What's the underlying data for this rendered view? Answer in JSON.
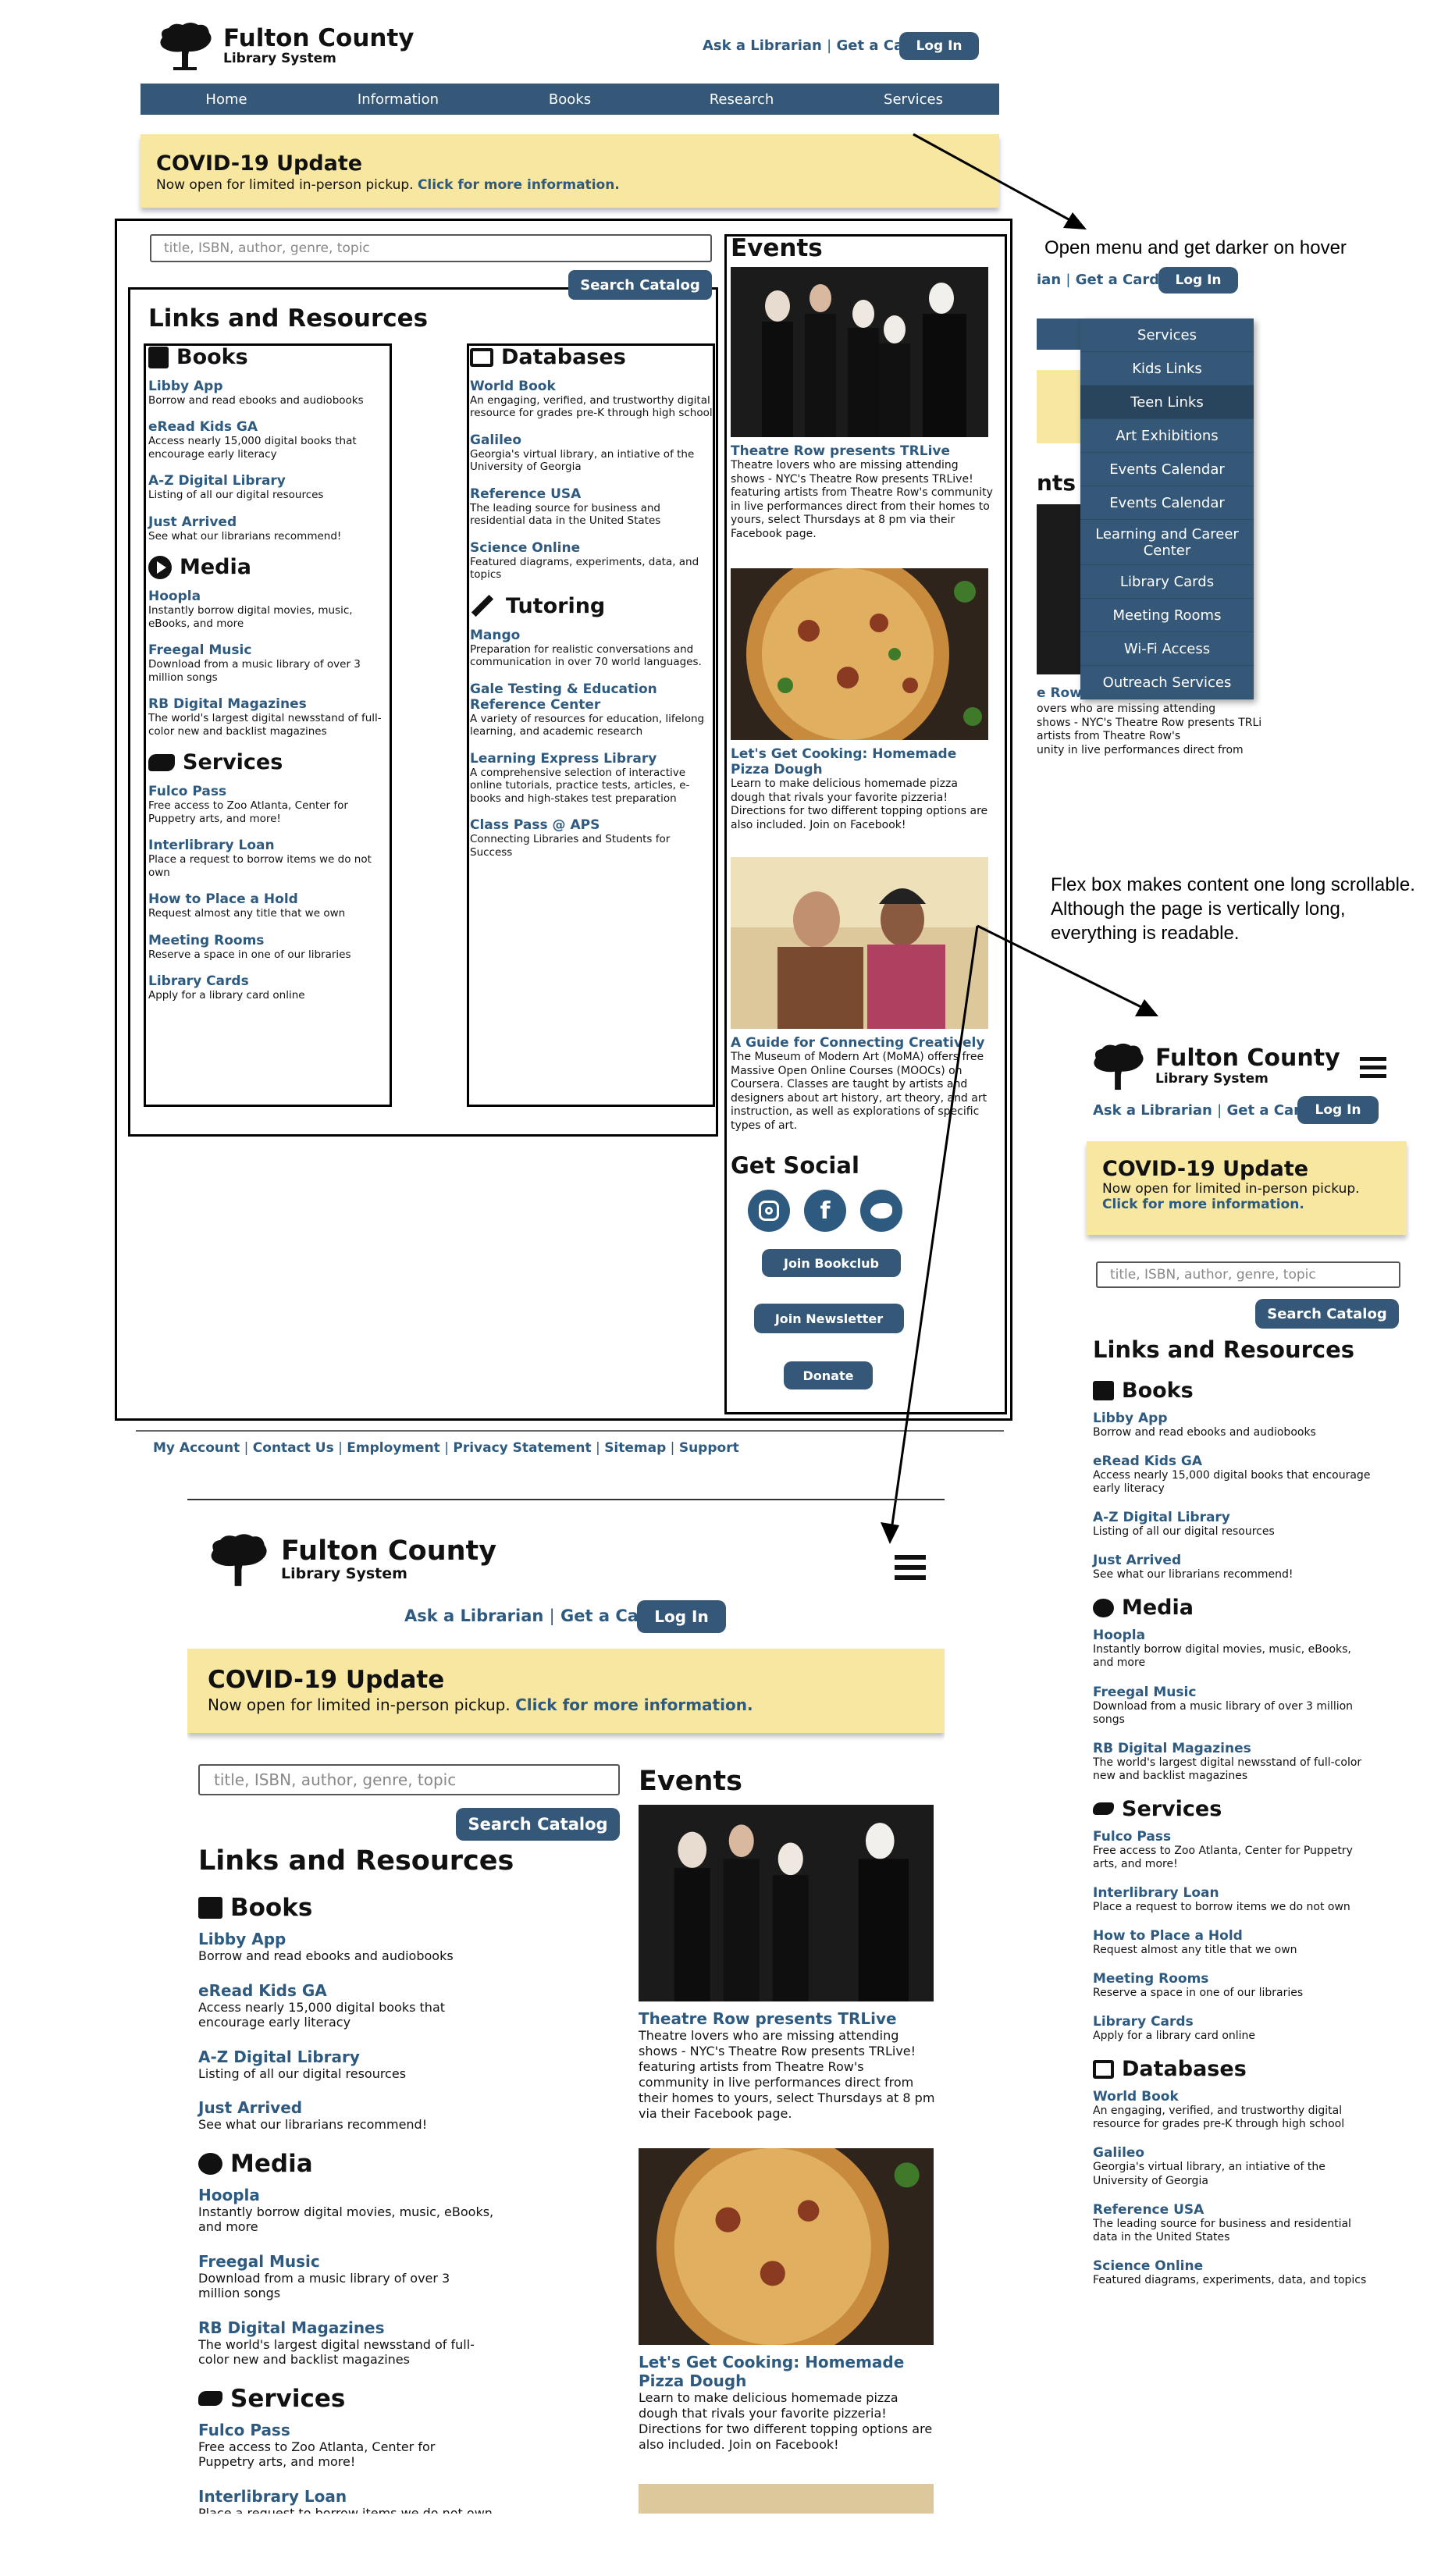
{
  "brand": {
    "title": "Fulton County",
    "subtitle": "Library System"
  },
  "header": {
    "ask": "Ask a Librarian",
    "sep": "|",
    "card": "Get a Card",
    "login": "Log In"
  },
  "nav": [
    "Home",
    "Information",
    "Books",
    "Research",
    "Services"
  ],
  "covid": {
    "title": "COVID-19 Update",
    "text": "Now open for limited in-person pickup.",
    "link": "Click for more information."
  },
  "search": {
    "placeholder": "title, ISBN, author, genre, topic",
    "button": "Search Catalog"
  },
  "links_title": "Links and Resources",
  "categories": {
    "books": {
      "title": "Books",
      "items": [
        {
          "t": "Libby App",
          "d": "Borrow and read ebooks and audiobooks"
        },
        {
          "t": "eRead Kids GA",
          "d": "Access nearly 15,000 digital books that encourage early literacy"
        },
        {
          "t": "A-Z Digital Library",
          "d": "Listing of all our digital resources"
        },
        {
          "t": "Just Arrived",
          "d": "See what our librarians recommend!"
        }
      ]
    },
    "media": {
      "title": "Media",
      "items": [
        {
          "t": "Hoopla",
          "d": "Instantly borrow digital movies, music, eBooks, and more"
        },
        {
          "t": "Freegal Music",
          "d": "Download from a music library of over 3 million songs"
        },
        {
          "t": "RB Digital Magazines",
          "d": "The world's largest digital newsstand of full-color new and backlist magazines"
        }
      ]
    },
    "services": {
      "title": "Services",
      "items": [
        {
          "t": "Fulco Pass",
          "d": "Free access to Zoo Atlanta, Center for Puppetry arts, and more!"
        },
        {
          "t": "Interlibrary Loan",
          "d": "Place a request to borrow items we do not own"
        },
        {
          "t": "How to Place a Hold",
          "d": "Request almost any title that we own"
        },
        {
          "t": "Meeting Rooms",
          "d": "Reserve a space in one of our libraries"
        },
        {
          "t": "Library Cards",
          "d": "Apply for a library card online"
        }
      ]
    },
    "databases": {
      "title": "Databases",
      "items": [
        {
          "t": "World Book",
          "d": "An engaging, verified, and trustworthy digital resource for grades pre-K through high school"
        },
        {
          "t": "Galileo",
          "d": "Georgia's virtual library, an intiative of the University of Georgia"
        },
        {
          "t": "Reference USA",
          "d": "The leading source for business and residential data in the United States"
        },
        {
          "t": "Science Online",
          "d": "Featured diagrams, experiments, data, and topics"
        }
      ]
    },
    "tutoring": {
      "title": "Tutoring",
      "items": [
        {
          "t": "Mango",
          "d": "Preparation for realistic conversations and communication in over 70 world languages."
        },
        {
          "t": "Gale Testing & Education Reference Center",
          "d": "A variety of resources for education, lifelong learning, and academic research"
        },
        {
          "t": "Learning Express Library",
          "d": "A comprehensive selection of interactive online tutorials, practice tests, articles, e-books and high-stakes test preparation"
        },
        {
          "t": "Class Pass @ APS",
          "d": "Connecting Libraries and Students for Success"
        }
      ]
    }
  },
  "events": {
    "title": "Events",
    "items": [
      {
        "t": "Theatre Row presents TRLive",
        "d": "Theatre lovers who are missing attending shows - NYC's Theatre Row presents TRLive! featuring artists from Theatre Row's community in live performances direct from their homes to yours, select Thursdays at 8 pm via their Facebook page."
      },
      {
        "t": "Let's Get Cooking: Homemade Pizza Dough",
        "d": "Learn to make delicious homemade pizza dough that rivals your favorite pizzeria! Directions for two different topping options are also included. Join on Facebook!"
      },
      {
        "t": "A Guide for Connecting Creatively",
        "d": "The Museum of Modern Art (MoMA) offers free Massive Open Online Courses (MOOCs) on Coursera. Classes are taught by artists and designers about art history, art theory, and art instruction, as well as explorations of specific types of art."
      }
    ]
  },
  "social": {
    "title": "Get Social",
    "bookclub": "Join Bookclub",
    "newsletter": "Join Newsletter",
    "donate": "Donate"
  },
  "footer": [
    "My Account",
    "Contact Us",
    "Employment",
    "Privacy Statement",
    "Sitemap",
    "Support"
  ],
  "menu": [
    "Services",
    "Kids Links",
    "Teen Links",
    "Art Exhibitions",
    "Events Calendar",
    "Events Calendar",
    "Learning and Career Center",
    "Library Cards",
    "Meeting Rooms",
    "Wi-Fi Access",
    "Outreach Services"
  ],
  "notes": {
    "menu": "Open menu and get darker on hover",
    "flex": "Flex box makes content one long scrollable. Although the page is vertically long, everything is readable."
  },
  "crop": {
    "topl_frag": "ian",
    "card": "Get a Card",
    "events_frag": "nts",
    "ev_frag": "e Row",
    "ev_line1": "overs who are missing attending",
    "ev_line2": "shows - NYC's Theatre Row presents TRLive!",
    "ev_line3": "artists from Theatre Row's",
    "ev_line4": "unity in live performances direct from",
    "db_frag": "Reference USA"
  },
  "colors": {
    "navy": "#355878",
    "link": "#2e5a80",
    "banner": "#f7e7a0"
  }
}
